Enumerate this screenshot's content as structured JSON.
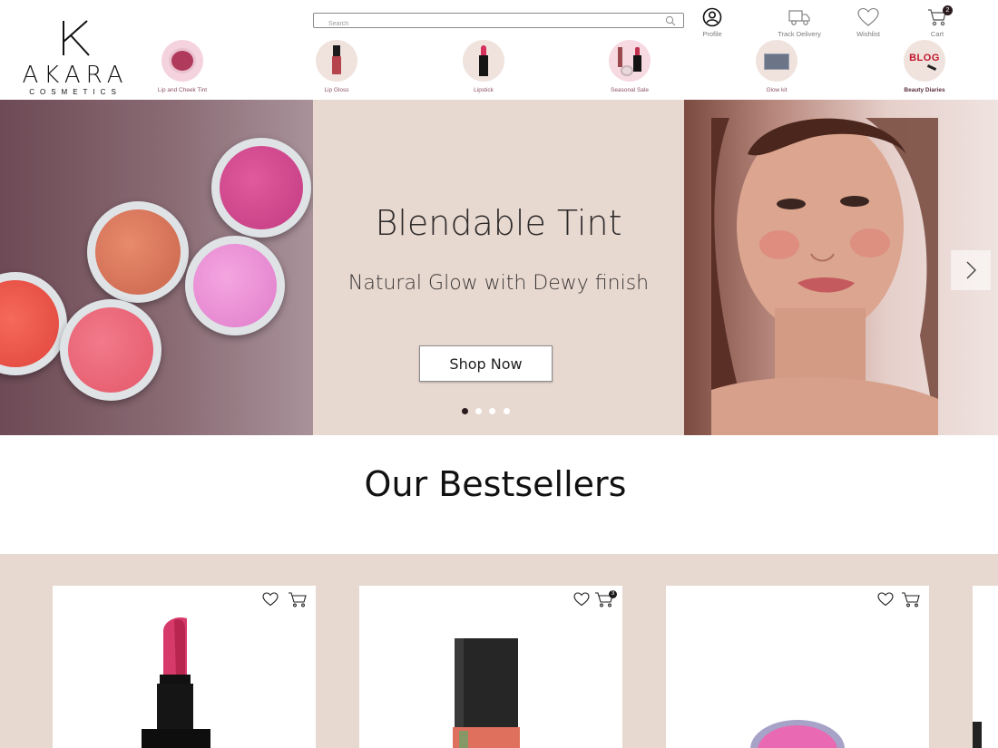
{
  "brand": {
    "name": "AKARA",
    "sub": "COSMETICS"
  },
  "search": {
    "placeholder": "Search"
  },
  "header_actions": [
    {
      "label": "Profile",
      "icon": "user-icon"
    },
    {
      "label": "Track Delivery",
      "icon": "truck-icon"
    },
    {
      "label": "Wishlist",
      "icon": "heart-icon"
    },
    {
      "label": "Cart",
      "icon": "cart-icon",
      "badge": "2"
    }
  ],
  "categories": [
    {
      "label": "Lip and Cheek Tint"
    },
    {
      "label": "Lip Gloss"
    },
    {
      "label": "Lipstick"
    },
    {
      "label": "Seasonal Sale"
    },
    {
      "label": "Glow kit"
    },
    {
      "label": "Beauty Diaries",
      "image_text": "BLOG"
    }
  ],
  "hero": {
    "title": "Blendable Tint",
    "subtitle": "Natural Glow with Dewy finish",
    "cta": "Shop Now",
    "slide_count": 4,
    "active_slide": 1
  },
  "bestsellers": {
    "title": "Our Bestsellers",
    "products": [
      {
        "type": "lipstick",
        "cart_badge": ""
      },
      {
        "type": "lip-gloss",
        "cart_badge": "3"
      },
      {
        "type": "tint-pot",
        "cart_badge": ""
      }
    ]
  },
  "colors": {
    "accent": "#2b1a1e",
    "beige": "#e8d9d0",
    "rose": "#8c5362"
  }
}
